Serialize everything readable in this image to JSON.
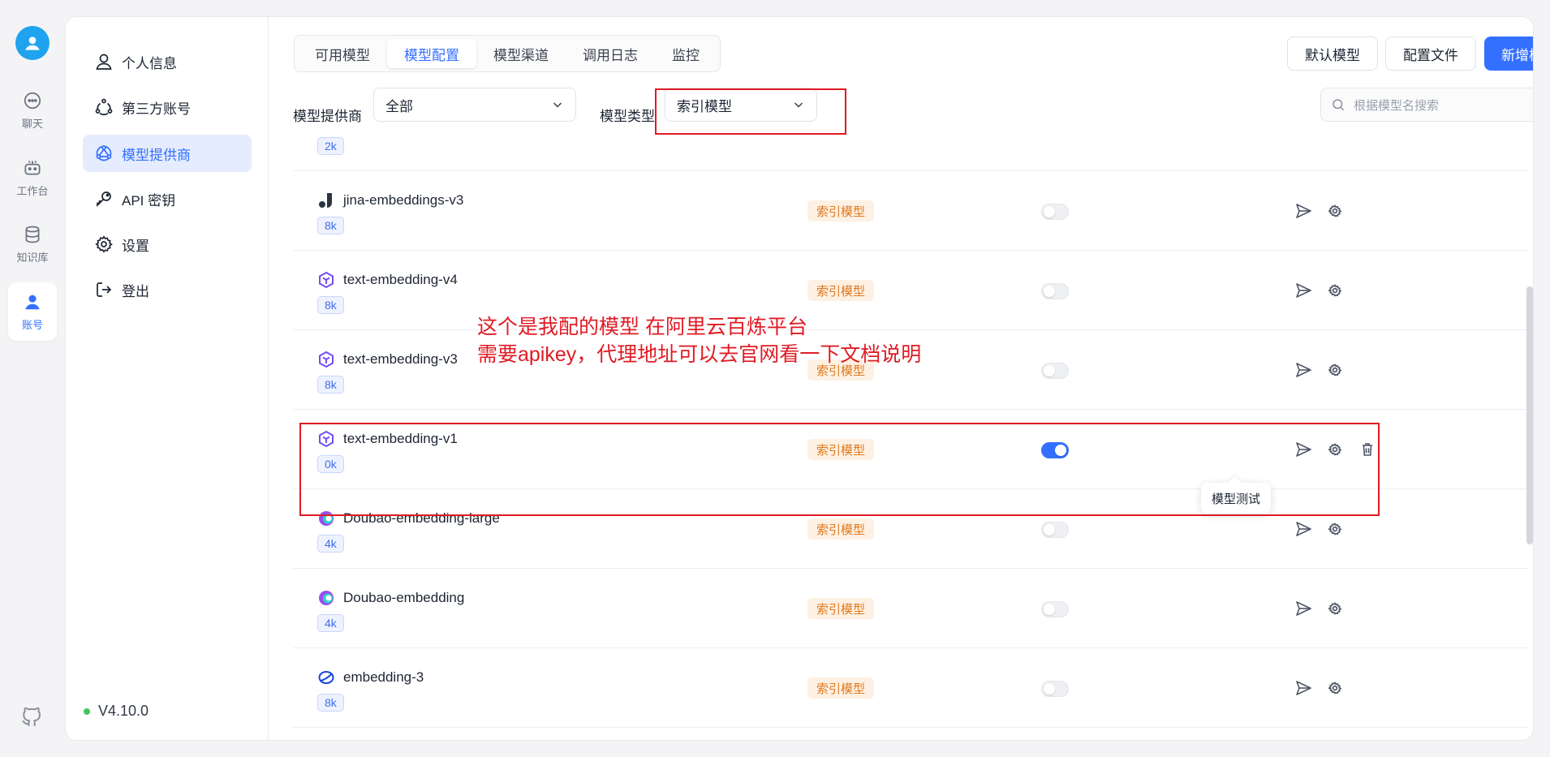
{
  "rail": {
    "items": [
      {
        "label": "聊天",
        "icon": "chat-icon"
      },
      {
        "label": "工作台",
        "icon": "robot-icon"
      },
      {
        "label": "知识库",
        "icon": "database-icon"
      },
      {
        "label": "账号",
        "icon": "user-icon"
      }
    ],
    "github_icon": "github-icon"
  },
  "sidebar": {
    "items": [
      {
        "label": "个人信息",
        "icon": "user-icon"
      },
      {
        "label": "第三方账号",
        "icon": "share-icon"
      },
      {
        "label": "模型提供商",
        "icon": "network-icon"
      },
      {
        "label": "API 密钥",
        "icon": "key-icon"
      },
      {
        "label": "设置",
        "icon": "gear-icon"
      },
      {
        "label": "登出",
        "icon": "logout-icon"
      }
    ],
    "active_item": "模型提供商",
    "version": "V4.10.0"
  },
  "tabs": [
    "可用模型",
    "模型配置",
    "模型渠道",
    "调用日志",
    "监控"
  ],
  "active_tab": "模型配置",
  "actions": {
    "default_model": "默认模型",
    "config_file": "配置文件",
    "add_model": "新增模型"
  },
  "filters": {
    "provider_label": "模型提供商",
    "provider_value": "全部",
    "type_label": "模型类型",
    "type_value": "索引模型",
    "search_placeholder": "根据模型名搜索"
  },
  "models": [
    {
      "name": "",
      "context": "2k",
      "type": "索引模型",
      "enabled": false,
      "logo": "partial-row"
    },
    {
      "name": "jina-embeddings-v3",
      "context": "8k",
      "type": "索引模型",
      "enabled": false,
      "logo": "jina-logo"
    },
    {
      "name": "text-embedding-v4",
      "context": "8k",
      "type": "索引模型",
      "enabled": false,
      "logo": "qwen-logo"
    },
    {
      "name": "text-embedding-v3",
      "context": "8k",
      "type": "索引模型",
      "enabled": false,
      "logo": "qwen-logo"
    },
    {
      "name": "text-embedding-v1",
      "context": "0k",
      "type": "索引模型",
      "enabled": true,
      "logo": "qwen-logo"
    },
    {
      "name": "Doubao-embedding-large",
      "context": "4k",
      "type": "索引模型",
      "enabled": false,
      "logo": "doubao-logo"
    },
    {
      "name": "Doubao-embedding",
      "context": "4k",
      "type": "索引模型",
      "enabled": false,
      "logo": "doubao-logo"
    },
    {
      "name": "embedding-3",
      "context": "8k",
      "type": "索引模型",
      "enabled": false,
      "logo": "zhipu-logo"
    }
  ],
  "tooltip": "模型测试",
  "annotation": {
    "line1": "这个是我配的模型 在阿里云百炼平台",
    "line2": "需要apikey，代理地址可以去官网看一下文档说明"
  },
  "colors": {
    "accent": "#3370ff",
    "type_badge_text": "#e0791d",
    "annotation": "#e01b24",
    "online_dot": "#46c35f"
  }
}
